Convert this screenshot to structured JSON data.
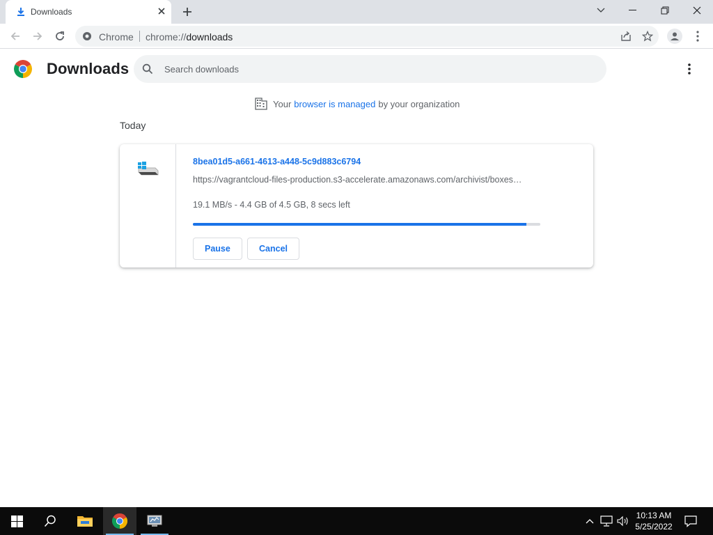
{
  "browser": {
    "tab": {
      "title": "Downloads",
      "icon": "download-icon"
    },
    "omnibox": {
      "scheme_label": "Chrome",
      "url_prefix": "chrome://",
      "url_path": "downloads"
    }
  },
  "page": {
    "title": "Downloads",
    "search": {
      "placeholder": "Search downloads",
      "value": ""
    },
    "managed": {
      "prefix": "Your",
      "link": "browser is managed",
      "suffix": "by your organization"
    },
    "date_heading": "Today"
  },
  "download": {
    "file_name": "8bea01d5-a661-4613-a448-5c9d883c6794",
    "url": "https://vagrantcloud-files-production.s3-accelerate.amazonaws.com/archivist/boxes…",
    "status": "19.1 MB/s - 4.4 GB of 4.5 GB, 8 secs left",
    "progress_fraction": 0.96,
    "buttons": {
      "pause": "Pause",
      "cancel": "Cancel"
    }
  },
  "taskbar": {
    "items": [
      "start-icon",
      "search-icon",
      "file-explorer-icon",
      "chrome-icon",
      "server-manager-icon"
    ],
    "active": "chrome-icon",
    "clock": {
      "time": "10:13 AM",
      "date": "5/25/2022"
    }
  },
  "colors": {
    "accent": "#1a73e8",
    "tabstrip": "#dee1e6",
    "taskbar": "#0b0b0b"
  }
}
